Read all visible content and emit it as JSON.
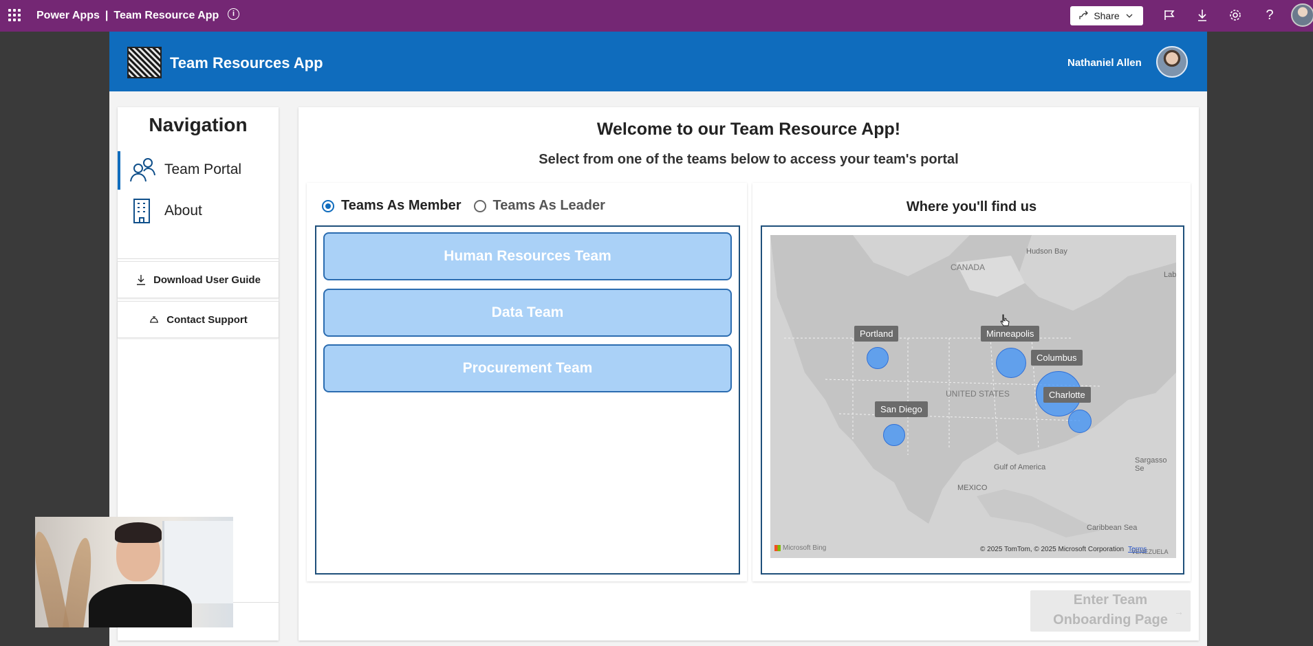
{
  "topbar": {
    "product": "Power Apps",
    "separator": "|",
    "app_name": "Team Resource App",
    "share_label": "Share"
  },
  "header": {
    "title": "Team Resources App",
    "user_name": "Nathaniel Allen"
  },
  "nav": {
    "title": "Navigation",
    "items": [
      {
        "label": "Team Portal",
        "icon": "people-icon",
        "active": true
      },
      {
        "label": "About",
        "icon": "building-icon",
        "active": false
      }
    ],
    "download_label": "Download User Guide",
    "support_label": "Contact Support"
  },
  "main": {
    "welcome": "Welcome to our Team Resource App!",
    "subtitle": "Select from one of the teams below to access your team's portal",
    "radio": {
      "member_label": "Teams As Member",
      "leader_label": "Teams As Leader",
      "selected": "member"
    },
    "teams": [
      "Human Resources Team",
      "Data Team",
      "Procurement Team"
    ],
    "enter_button": {
      "line1": "Enter Team",
      "line2": "Onboarding Page",
      "arrow": "→"
    }
  },
  "map": {
    "title": "Where you'll find us",
    "region_labels": {
      "canada": "CANADA",
      "hudson_bay": "Hudson Bay",
      "united_states": "UNITED STATES",
      "mexico": "MEXICO",
      "gulf": "Gulf of America",
      "sargasso": "Sargasso Se",
      "caribbean": "Caribbean Sea",
      "labrador": "Lab",
      "venezuela": "VENEZUELA"
    },
    "locations": [
      "Portland",
      "Minneapolis",
      "Columbus",
      "Charlotte",
      "San Diego"
    ],
    "attribution": "Microsoft Bing",
    "copyright": "© 2025 TomTom, © 2025 Microsoft Corporation",
    "terms": "Terms"
  }
}
